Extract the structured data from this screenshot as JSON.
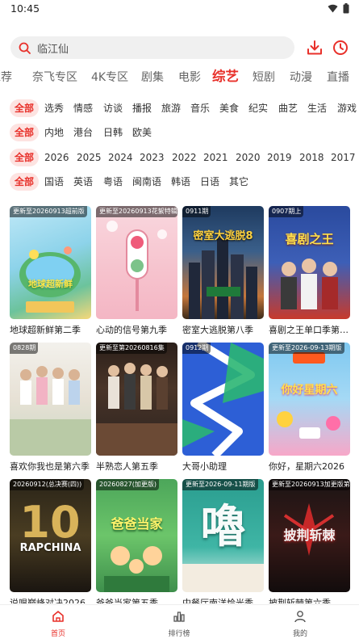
{
  "status": {
    "time": "10:45"
  },
  "search": {
    "placeholder": "临江仙"
  },
  "colors": {
    "accent": "#e8302a",
    "chip_bg": "#fde3e1"
  },
  "category_tabs": [
    "推荐",
    "奈飞专区",
    "4K专区",
    "剧集",
    "电影",
    "综艺",
    "短剧",
    "动漫",
    "直播"
  ],
  "active_category": "综艺",
  "filters": {
    "genre": [
      "全部",
      "选秀",
      "情感",
      "访谈",
      "播报",
      "旅游",
      "音乐",
      "美食",
      "纪实",
      "曲艺",
      "生活",
      "游戏"
    ],
    "region": [
      "全部",
      "内地",
      "港台",
      "日韩",
      "欧美"
    ],
    "year": [
      "全部",
      "2026",
      "2025",
      "2024",
      "2023",
      "2022",
      "2021",
      "2020",
      "2019",
      "2018",
      "2017"
    ],
    "language": [
      "全部",
      "国语",
      "英语",
      "粤语",
      "闽南语",
      "韩语",
      "日语",
      "其它"
    ]
  },
  "shows": [
    {
      "title": "地球超新鲜第二季",
      "badge": "更新至20260913超前版",
      "poster_text": "地球超新鲜",
      "poster_icon": "blue-green-globe"
    },
    {
      "title": "心动的信号第九季",
      "badge": "更新至20260913花絮特辑",
      "poster_text": "",
      "poster_icon": "pink-traffic-light"
    },
    {
      "title": "密室大逃脱第八季",
      "badge": "0911期",
      "poster_text": "密室大逃脱8",
      "poster_icon": "city-skyline"
    },
    {
      "title": "喜剧之王单口季第…",
      "badge": "0907期上",
      "poster_text": "喜剧之王",
      "poster_icon": "comedians-group"
    },
    {
      "title": "喜欢你我也是第六季",
      "badge": "0828期",
      "poster_text": "",
      "poster_icon": "group-photo"
    },
    {
      "title": "半熟恋人第五季",
      "badge": "更新至第20260816集",
      "poster_text": "",
      "poster_icon": "couple-stage"
    },
    {
      "title": "大哥小助理",
      "badge": "0912期",
      "poster_text": "",
      "poster_icon": "blue-green-zigzag"
    },
    {
      "title": "你好，星期六2026",
      "badge": "更新至2026-09-13期版",
      "poster_text": "你好星期六",
      "poster_icon": "colorful-party"
    },
    {
      "title": "说唱巅峰对决2026",
      "badge": "20260912(总决赛(四))",
      "poster_text": "RAPCHINA",
      "poster_icon": "gold-ten"
    },
    {
      "title": "爸爸当家第五季",
      "badge": "20260827(加更版)",
      "poster_text": "爸爸当家",
      "poster_icon": "green-cartoon"
    },
    {
      "title": "中餐厅南洋烩光季",
      "badge": "更新至2026-09-11期版",
      "poster_text": "嚕",
      "poster_icon": "teal-chinese-char"
    },
    {
      "title": "披荆斩棘第六季",
      "badge": "更新至20260913加更版第",
      "poster_text": "披荆斩棘",
      "poster_icon": "dark-red-logo"
    }
  ],
  "bottom_nav": [
    {
      "label": "首页",
      "icon": "home-icon"
    },
    {
      "label": "排行榜",
      "icon": "bar-chart-icon"
    },
    {
      "label": "我的",
      "icon": "user-icon"
    }
  ]
}
